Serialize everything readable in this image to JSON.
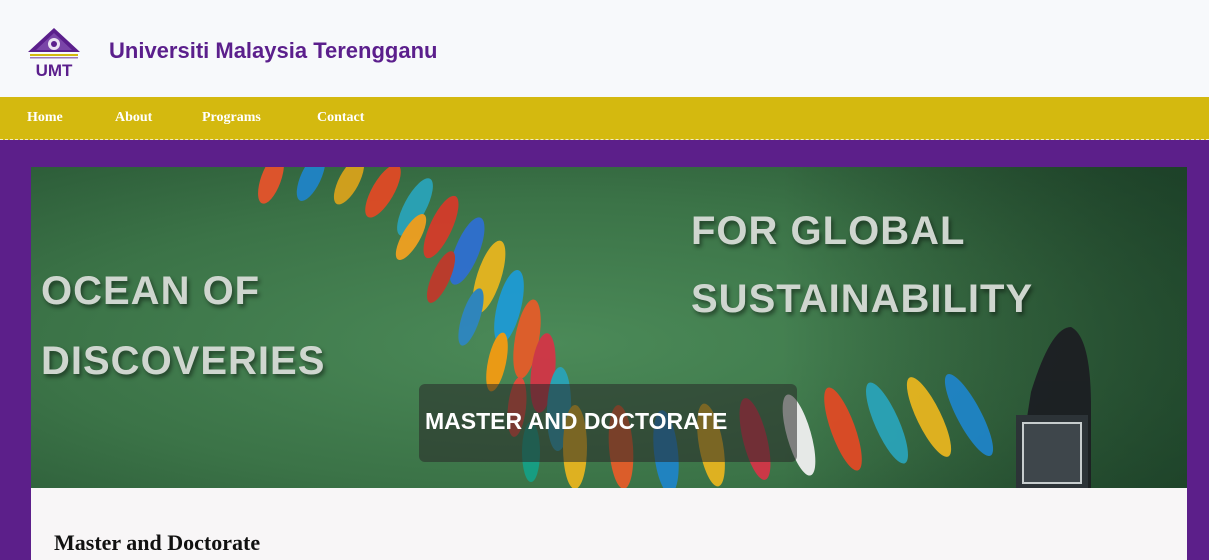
{
  "header": {
    "site_title": "Universiti Malaysia Terengganu",
    "logo_text": "UMT"
  },
  "nav": {
    "items": [
      {
        "label": "Home"
      },
      {
        "label": "About"
      },
      {
        "label": "Programs"
      },
      {
        "label": "Contact"
      }
    ]
  },
  "hero": {
    "left_line_1": "OCEAN OF",
    "left_line_2": "DISCOVERIES",
    "right_line_1": "FOR GLOBAL",
    "right_line_2": "SUSTAINABILITY",
    "caption": "MASTER AND DOCTORATE"
  },
  "content": {
    "section_title": "Master and Doctorate"
  },
  "colors": {
    "brand_purple": "#5c1f8a",
    "nav_gold": "#d4b90f",
    "header_bg": "#f7f9fb",
    "water_green": "#3f7a4d"
  }
}
